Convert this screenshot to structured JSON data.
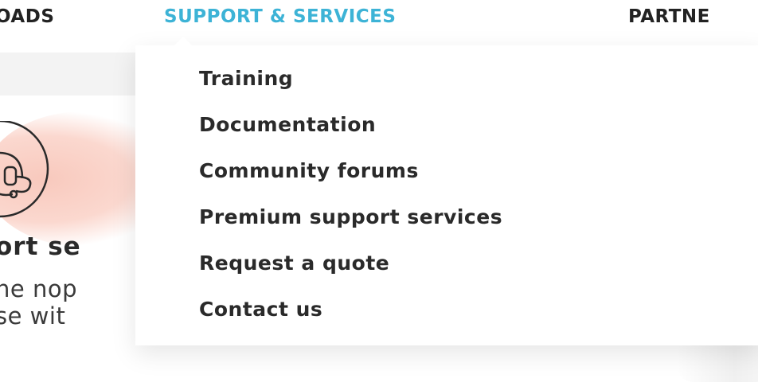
{
  "nav": {
    "items": [
      {
        "label": "OADS",
        "active": false
      },
      {
        "label": "SUPPORT & SERVICES",
        "active": true
      },
      {
        "label": "PARTNE",
        "active": false
      }
    ]
  },
  "background_card": {
    "title": "ort se",
    "text_line_1": "ne nop",
    "text_line_2": "se wit",
    "icon": "headset-support-icon"
  },
  "dropdown": {
    "items": [
      {
        "label": "Training"
      },
      {
        "label": "Documentation"
      },
      {
        "label": "Community forums"
      },
      {
        "label": "Premium support services"
      },
      {
        "label": "Request a quote"
      },
      {
        "label": "Contact us"
      }
    ]
  },
  "colors": {
    "active_nav": "#3db3d6",
    "text": "#2a2a2a",
    "accent_pink": "#f8c9bd"
  }
}
